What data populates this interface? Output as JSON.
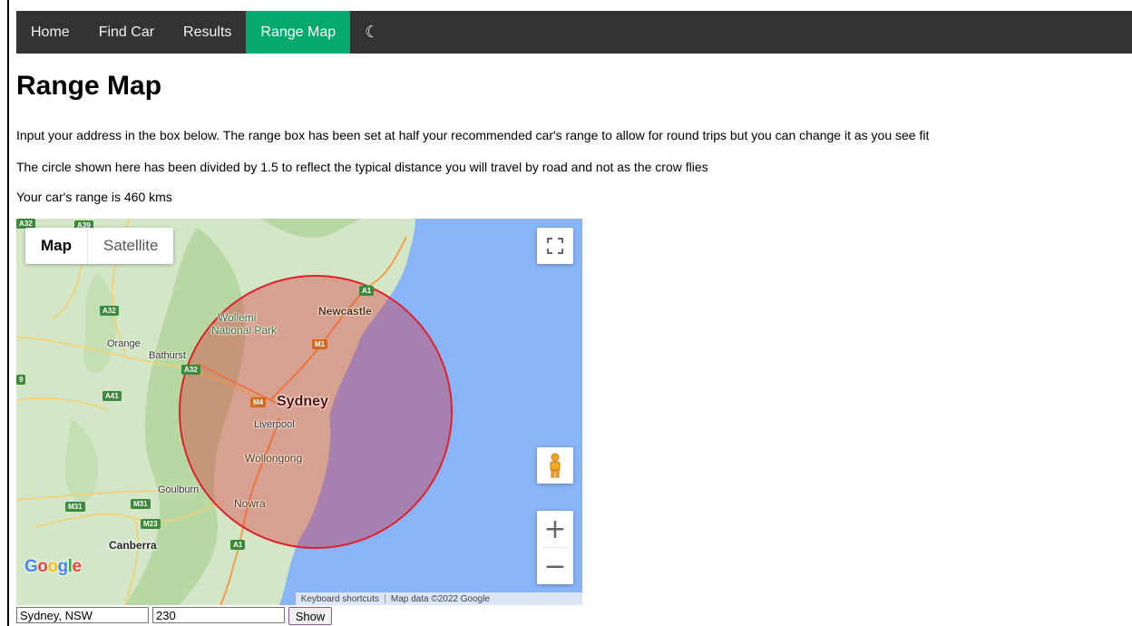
{
  "nav": {
    "items": [
      "Home",
      "Find Car",
      "Results",
      "Range Map"
    ],
    "active_index": 3,
    "theme_icon": "moon-icon",
    "theme_glyph": "☾",
    "bg": "#333333",
    "active_color": "#04AA6D"
  },
  "page": {
    "title": "Range Map",
    "para1": "Input your address in the box below. The range box has been set at half your recommended car's range to allow for round trips but you can change it as you see fit",
    "para2": "The circle shown here has been divided by 1.5 to reflect the typical distance you will travel by road and not as the crow flies",
    "para3": "Your car's range is 460 kms"
  },
  "map": {
    "type_map": "Map",
    "type_satellite": "Satellite",
    "fullscreen_icon": "fullscreen-icon",
    "pegman_icon": "pegman-icon",
    "zoom_in": "+",
    "zoom_out": "−",
    "logo": "Google",
    "attribution_shortcuts": "Keyboard shortcuts",
    "attribution_data": "Map data ©2022 Google",
    "circle_color": "#e0202a",
    "water_color": "#8ab4f8",
    "places": {
      "newcastle": "Newcastle",
      "wollemi": "Wollemi",
      "national_park": "National Park",
      "orange": "Orange",
      "bathurst": "Bathurst",
      "sydney": "Sydney",
      "liverpool": "Liverpool",
      "wollongong": "Wollongong",
      "goulburn": "Goulburn",
      "nowra": "Nowra",
      "canberra": "Canberra"
    },
    "roads": [
      "A32",
      "A39",
      "A1",
      "M1",
      "A32",
      "A32",
      "A41",
      "M4",
      "M31",
      "M31",
      "M23",
      "A1",
      "9"
    ]
  },
  "form": {
    "address_value": "Sydney, NSW",
    "range_value": "230",
    "show_label": "Show"
  }
}
